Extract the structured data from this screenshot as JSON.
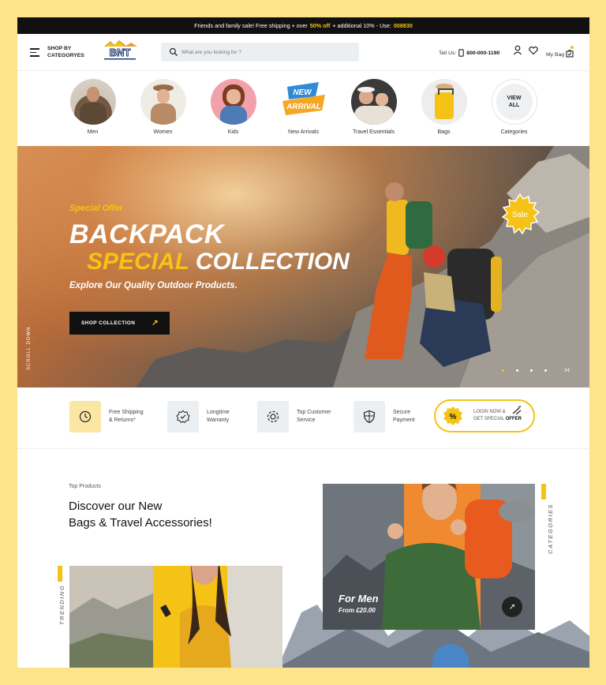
{
  "topbar": {
    "text_a": "Friends and family sale! Free shipping + over",
    "highlight_a": "50% off",
    "text_b": "+ additional 10% - Use:",
    "code": "008830"
  },
  "header": {
    "shop_by_line1": "SHOP BY",
    "shop_by_line2": "CATEGORYES",
    "logo_text": "BNT",
    "search_placeholder": "What are you looking for ?",
    "tell_label": "Tell Us:",
    "phone": "800-000-1190",
    "bag_label": "My Bag"
  },
  "categories": [
    {
      "label": "Men"
    },
    {
      "label": "Women"
    },
    {
      "label": "Kids"
    },
    {
      "label": "New Arrivals",
      "badge_top": "NEW",
      "badge_bottom": "ARRIVAL"
    },
    {
      "label": "Travel Essentials"
    },
    {
      "label": "Bags"
    },
    {
      "label": "Categories",
      "view_all_line1": "VIEW",
      "view_all_line2": "ALL"
    }
  ],
  "hero": {
    "eyebrow": "Special Offer",
    "title_line1": "BACKPACK",
    "title_highlight": "SPECIAL",
    "title_rest": "COLLECTION",
    "subtitle": "Explore Our Quality Outdoor Products.",
    "cta": "SHOP COLLECTION",
    "scroll_label": "SCROLL DOWN",
    "sale_badge": "Sale",
    "slide_count": 4,
    "active_slide": 1
  },
  "features": [
    {
      "line1": "Free Shipping",
      "line2": "& Returns*",
      "icon": "clock-arrow-icon"
    },
    {
      "line1": "Longtime",
      "line2": "Warranty",
      "icon": "badge-check-icon"
    },
    {
      "line1": "Top Customer",
      "line2": "Service",
      "icon": "gear-icon"
    },
    {
      "line1": "Secure",
      "line2": "Payment",
      "icon": "shield-icon"
    }
  ],
  "login_offer": {
    "line1": "LOGIN NOW &",
    "line2_prefix": "GET SPECIAL",
    "line2_bold": "OFFER",
    "icon_text": "%"
  },
  "top_products": {
    "label": "Top Products",
    "title_line1": "Discover our New",
    "title_line2": "Bags & Travel Accessories!",
    "trending_label": "TRENDING",
    "categories_label": "CATEGORIES",
    "card_title": "For Men",
    "card_price": "From £20.00"
  },
  "colors": {
    "accent": "#f5c315",
    "dark": "#111111",
    "page_bg": "#fde38a"
  }
}
